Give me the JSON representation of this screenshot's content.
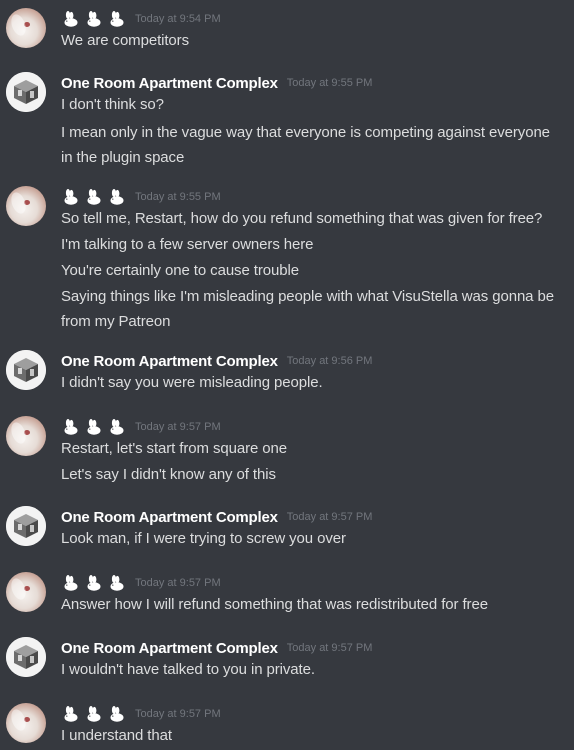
{
  "users": {
    "bunny": {
      "display": "🐇🐇🐇",
      "avatar": "bunny-avatar"
    },
    "room": {
      "name": "One Room Apartment Complex",
      "avatar": "one-room-avatar"
    }
  },
  "messages": [
    {
      "author": "bunny",
      "time": "Today at 9:54 PM",
      "lines": [
        "We are competitors"
      ]
    },
    {
      "author": "room",
      "time": "Today at 9:55 PM",
      "lines": [
        "I don't think so?",
        "I mean only in the vague way that everyone is competing against everyone in the plugin space"
      ]
    },
    {
      "author": "bunny",
      "time": "Today at 9:55 PM",
      "lines": [
        "So tell me, Restart, how do you refund something that was given for free?",
        "I'm talking to a few server owners here",
        "You're certainly one to cause trouble",
        "Saying things like I'm misleading people with what VisuStella was gonna be from my Patreon"
      ]
    },
    {
      "author": "room",
      "time": "Today at 9:56 PM",
      "lines": [
        "I didn't say you were misleading people."
      ]
    },
    {
      "author": "bunny",
      "time": "Today at 9:57 PM",
      "lines": [
        "Restart, let's start from square one",
        "Let's say I didn't know any of this"
      ]
    },
    {
      "author": "room",
      "time": "Today at 9:57 PM",
      "lines": [
        "Look man, if I were trying to screw you over"
      ]
    },
    {
      "author": "bunny",
      "time": "Today at 9:57 PM",
      "lines": [
        "Answer how I will refund something that was redistributed for free"
      ]
    },
    {
      "author": "room",
      "time": "Today at 9:57 PM",
      "lines": [
        "I wouldn't have talked to you in private."
      ]
    },
    {
      "author": "bunny",
      "time": "Today at 9:57 PM",
      "lines": [
        "I understand that"
      ]
    }
  ]
}
